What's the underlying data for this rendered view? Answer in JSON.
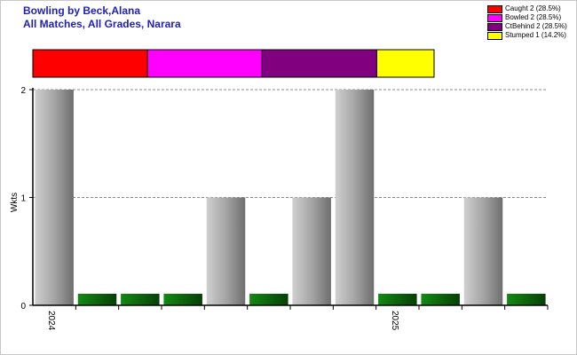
{
  "window": {
    "title_line1": "Bowling by Beck,Alana",
    "title_line2": "All Matches, All Grades, Narara"
  },
  "legend": {
    "items": [
      {
        "label": "Caught 2 (28.5%)",
        "color": "#ff0000"
      },
      {
        "label": "Bowled 2 (28.5%)",
        "color": "#ff00ff"
      },
      {
        "label": "CtBehind 2 (28.5%)",
        "color": "#800080"
      },
      {
        "label": "Stumped 1 (14.2%)",
        "color": "#ffff00"
      }
    ]
  },
  "chart_data": [
    {
      "type": "bar",
      "orientation": "horizontal-stacked",
      "series": [
        {
          "name": "Caught",
          "value": 2,
          "color": "#ff0000"
        },
        {
          "name": "Bowled",
          "value": 2,
          "color": "#ff00ff"
        },
        {
          "name": "CtBehind",
          "value": 2,
          "color": "#800080"
        },
        {
          "name": "Stumped",
          "value": 1,
          "color": "#ffff00"
        }
      ]
    },
    {
      "type": "bar",
      "ylabel": "Wkts",
      "ylim": [
        0,
        2
      ],
      "yticks": [
        "0",
        "1",
        "2"
      ],
      "grid": true,
      "values": [
        2,
        0,
        0,
        0,
        1,
        0,
        1,
        2,
        0,
        0,
        1,
        0
      ],
      "zero_marker_color": "#0b6b0b",
      "bar_color": "#9e9e9e",
      "x_labels": [
        {
          "index": 0,
          "label": "2024"
        },
        {
          "index": 8,
          "label": "2025"
        }
      ]
    }
  ]
}
